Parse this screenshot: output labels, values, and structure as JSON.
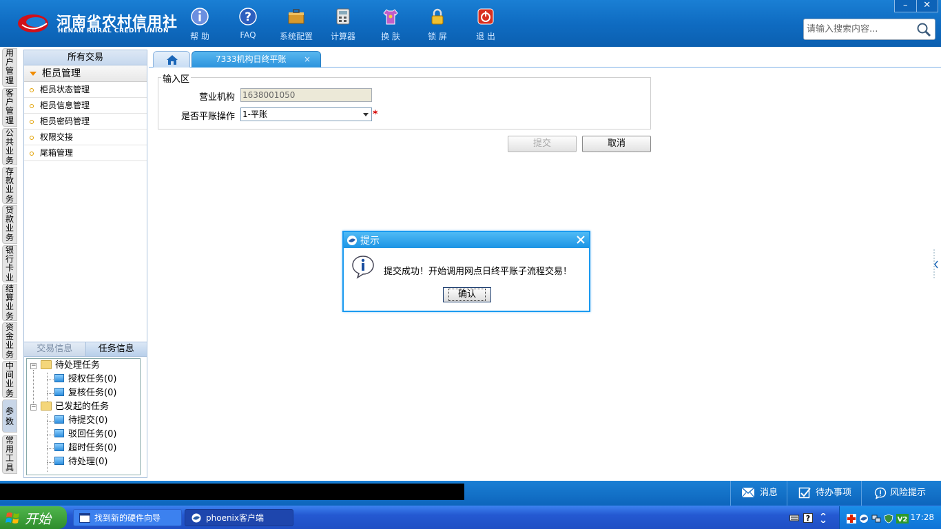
{
  "header": {
    "logo_cn": "河南省农村信用社",
    "logo_en": "HENAN RURAL CREDIT UNION",
    "tools": [
      {
        "label": "帮 助",
        "icon": "info-icon"
      },
      {
        "label": "FAQ",
        "icon": "question-icon"
      },
      {
        "label": "系统配置",
        "icon": "toolbox-icon"
      },
      {
        "label": "计算器",
        "icon": "calculator-icon"
      },
      {
        "label": "换 肤",
        "icon": "shirt-icon"
      },
      {
        "label": "锁 屏",
        "icon": "lock-icon"
      },
      {
        "label": "退 出",
        "icon": "power-icon"
      }
    ],
    "search_placeholder": "请输入搜索内容...",
    "minimize": "–",
    "close": "✕"
  },
  "vtabs": [
    "用户管理",
    "客户管理",
    "公共业务",
    "存款业务",
    "贷款业务",
    "银行卡业务",
    "结算业务",
    "资金业务",
    "中间业务",
    "参数",
    "常用工具"
  ],
  "leftpanel": {
    "header": "所有交易",
    "group": "柜员管理",
    "items": [
      "柜员状态管理",
      "柜员信息管理",
      "柜员密码管理",
      "权限交接",
      "尾箱管理"
    ],
    "bottom_tabs": [
      "交易信息",
      "任务信息"
    ],
    "tree": {
      "pending": "待处理任务",
      "pending_children": [
        "授权任务(0)",
        "复核任务(0)"
      ],
      "initiated": "已发起的任务",
      "initiated_children": [
        "待提交(0)",
        "驳回任务(0)",
        "超时任务(0)",
        "待处理(0)"
      ],
      "expand_symbol": "−"
    }
  },
  "main": {
    "tab_label": "7333机构日终平账",
    "tab_close": "×",
    "fieldset_legend": "输入区",
    "org_label": "营业机构",
    "org_value": "1638001050",
    "balance_label": "是否平账操作",
    "balance_value": "1-平账",
    "required": "*",
    "submit": "提交",
    "cancel": "取消"
  },
  "dialog": {
    "title": "提示",
    "message": "提交成功！开始调用网点日终平账子流程交易！",
    "ok": "确认"
  },
  "statusbar": {
    "messages": "消息",
    "todo": "待办事项",
    "risk": "风险提示"
  },
  "taskbar": {
    "start": "开始",
    "items": [
      "找到新的硬件向导",
      "phoenix客户端"
    ],
    "clock": "17:28"
  },
  "colors": {
    "header_blue": "#0f6cc2",
    "dialog_border": "#1a9af0",
    "required_red": "#d40000",
    "start_green": "#3a9e37"
  }
}
